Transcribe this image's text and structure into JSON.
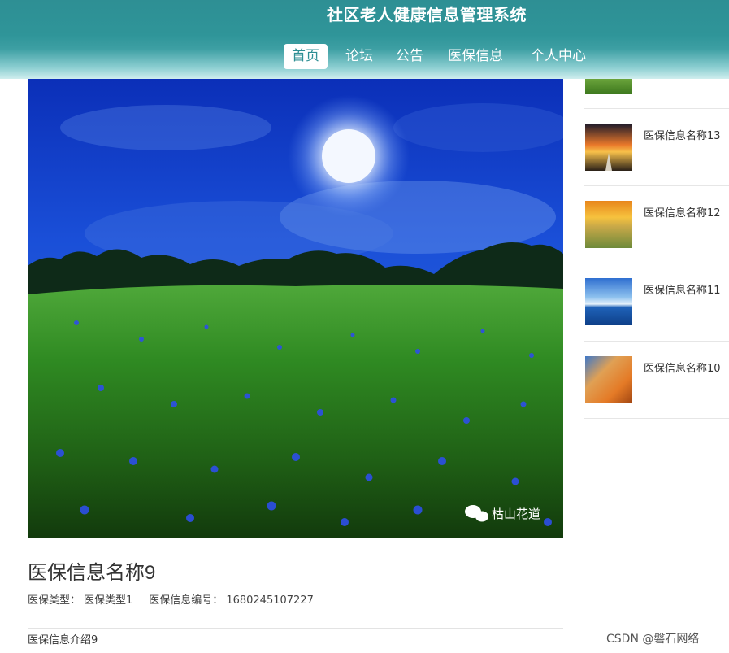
{
  "header": {
    "site_title": "社区老人健康信息管理系统",
    "nav": [
      {
        "label": "首页",
        "active": true
      },
      {
        "label": "论坛",
        "active": false
      },
      {
        "label": "公告",
        "active": false
      },
      {
        "label": "医保信息",
        "active": false
      },
      {
        "label": "个人中心",
        "active": false
      }
    ]
  },
  "main": {
    "image_watermark": "枯山花道",
    "title": "医保信息名称9",
    "meta": {
      "type_label": "医保类型：",
      "type_value": "医保类型1",
      "code_label": "医保信息编号：",
      "code_value": "1680245107227"
    },
    "intro": "医保信息介绍9"
  },
  "sidebar": {
    "items": [
      {
        "label": "医保信息名称13",
        "thumb": "sunset-road"
      },
      {
        "label": "医保信息名称12",
        "thumb": "golden-field"
      },
      {
        "label": "医保信息名称11",
        "thumb": "ocean-sky"
      },
      {
        "label": "医保信息名称10",
        "thumb": "orange-rock"
      }
    ]
  },
  "watermark": "CSDN @磐石网络",
  "colors": {
    "header_teal": "#2f9599",
    "nav_active_text": "#2f8f94"
  }
}
